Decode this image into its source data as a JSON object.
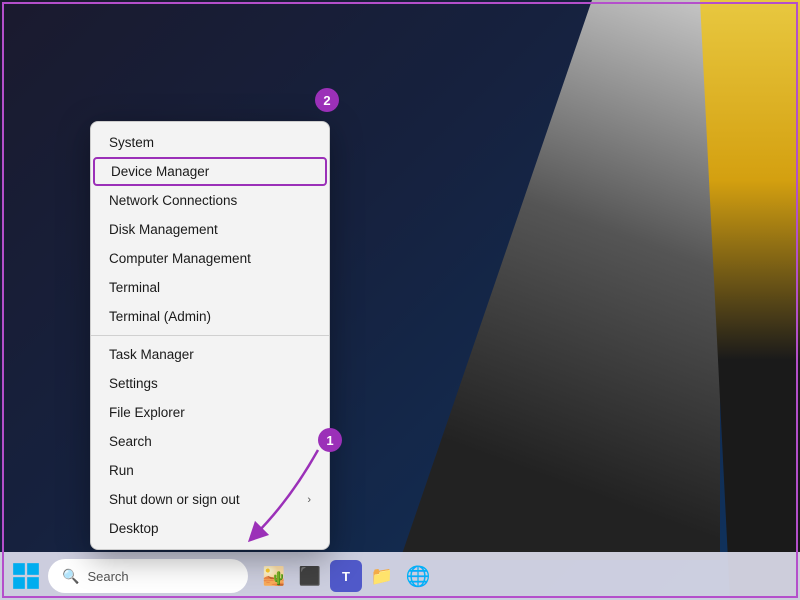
{
  "background": {
    "color": "#1a1a2e"
  },
  "taskbar": {
    "search_placeholder": "Search",
    "icons": [
      {
        "name": "landscape-icon",
        "symbol": "🏜️"
      },
      {
        "name": "task-view-icon",
        "symbol": "⬛"
      },
      {
        "name": "teams-icon",
        "symbol": "🟣"
      },
      {
        "name": "file-explorer-icon",
        "symbol": "🟡"
      },
      {
        "name": "edge-icon",
        "symbol": "🔵"
      }
    ]
  },
  "context_menu": {
    "items": [
      {
        "id": "system",
        "label": "System",
        "has_arrow": false,
        "divider_after": false
      },
      {
        "id": "device-manager",
        "label": "Device Manager",
        "has_arrow": false,
        "divider_after": false,
        "highlighted": true
      },
      {
        "id": "network-connections",
        "label": "Network Connections",
        "has_arrow": false,
        "divider_after": false
      },
      {
        "id": "disk-management",
        "label": "Disk Management",
        "has_arrow": false,
        "divider_after": false
      },
      {
        "id": "computer-management",
        "label": "Computer Management",
        "has_arrow": false,
        "divider_after": false
      },
      {
        "id": "terminal",
        "label": "Terminal",
        "has_arrow": false,
        "divider_after": false
      },
      {
        "id": "terminal-admin",
        "label": "Terminal (Admin)",
        "has_arrow": false,
        "divider_after": true
      },
      {
        "id": "task-manager",
        "label": "Task Manager",
        "has_arrow": false,
        "divider_after": false
      },
      {
        "id": "settings",
        "label": "Settings",
        "has_arrow": false,
        "divider_after": false
      },
      {
        "id": "file-explorer",
        "label": "File Explorer",
        "has_arrow": false,
        "divider_after": false
      },
      {
        "id": "search",
        "label": "Search",
        "has_arrow": false,
        "divider_after": false
      },
      {
        "id": "run",
        "label": "Run",
        "has_arrow": false,
        "divider_after": false
      },
      {
        "id": "shut-down",
        "label": "Shut down or sign out",
        "has_arrow": true,
        "divider_after": false
      },
      {
        "id": "desktop",
        "label": "Desktop",
        "has_arrow": false,
        "divider_after": false
      }
    ]
  },
  "badges": {
    "badge1": "1",
    "badge2": "2"
  },
  "annotations": {
    "arrow_color": "#9b30b8"
  }
}
